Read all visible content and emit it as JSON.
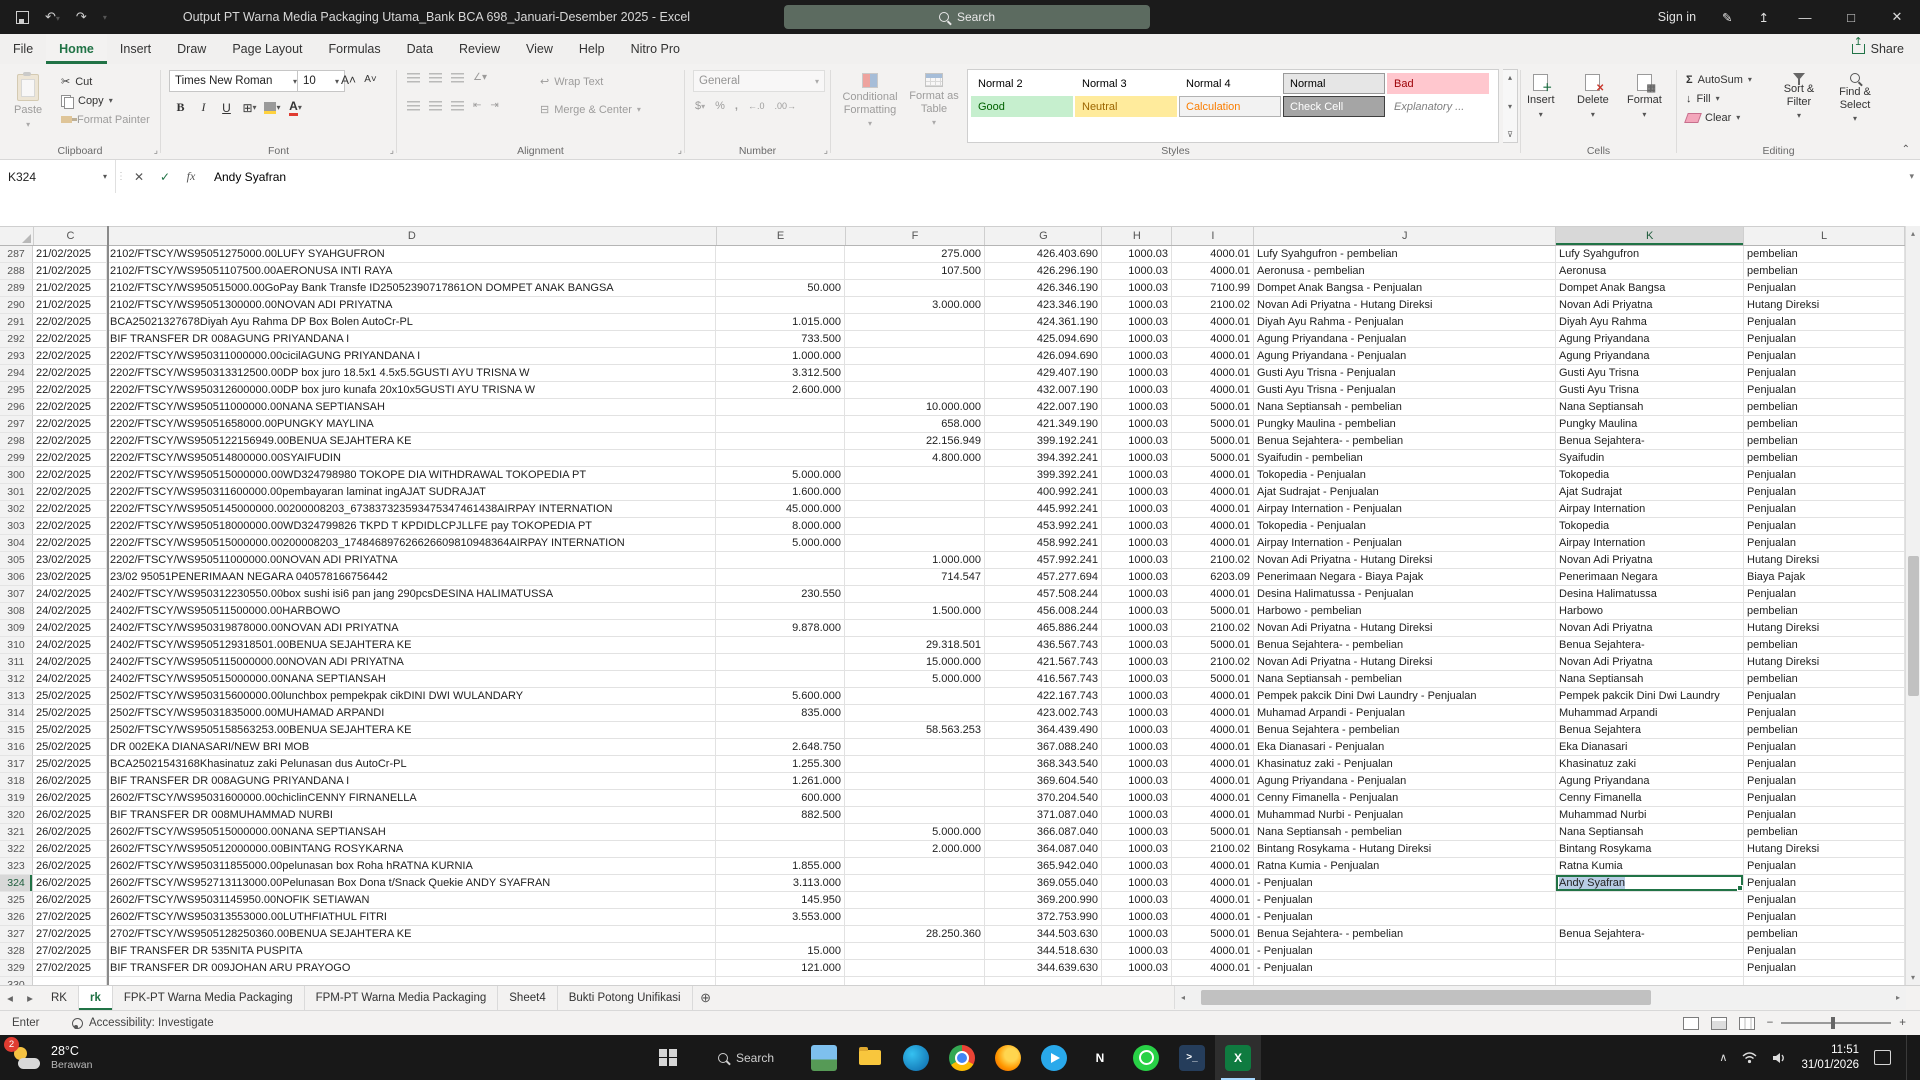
{
  "titlebar": {
    "title": "Output PT Warna Media Packaging Utama_Bank BCA 698_Januari-Desember 2025  -  Excel",
    "search_label": "Search",
    "sign_in_label": "Sign in"
  },
  "ribbon": {
    "tabs": [
      "File",
      "Home",
      "Insert",
      "Draw",
      "Page Layout",
      "Formulas",
      "Data",
      "Review",
      "View",
      "Help",
      "Nitro Pro"
    ],
    "active_tab": "Home",
    "share_label": "Share",
    "clipboard": {
      "group": "Clipboard",
      "paste": "Paste",
      "cut": "Cut",
      "copy": "Copy",
      "format_painter": "Format Painter"
    },
    "font": {
      "group": "Font",
      "name": "Times New Roman",
      "size": "10"
    },
    "alignment": {
      "group": "Alignment",
      "wrap": "Wrap Text",
      "merge": "Merge & Center"
    },
    "number": {
      "group": "Number",
      "format": "General"
    },
    "styles": {
      "group": "Styles",
      "conditional": "Conditional Formatting",
      "format_table": "Format as Table",
      "chips": [
        {
          "label": "Normal 2",
          "type": "normal"
        },
        {
          "label": "Normal 3",
          "type": "normal"
        },
        {
          "label": "Normal 4",
          "type": "normal"
        },
        {
          "label": "Normal",
          "type": "normal-selected"
        },
        {
          "label": "Bad",
          "type": "bad"
        },
        {
          "label": "Good",
          "type": "good"
        },
        {
          "label": "Neutral",
          "type": "neutral"
        },
        {
          "label": "Calculation",
          "type": "calculation"
        },
        {
          "label": "Check Cell",
          "type": "check"
        },
        {
          "label": "Explanatory ...",
          "type": "explanatory"
        }
      ]
    },
    "cells": {
      "group": "Cells",
      "insert": "Insert",
      "delete": "Delete",
      "format": "Format"
    },
    "editing": {
      "group": "Editing",
      "autosum": "AutoSum",
      "fill": "Fill",
      "clear": "Clear",
      "sort": "Sort & Filter",
      "find": "Find & Select"
    }
  },
  "formula_bar": {
    "name_box": "K324",
    "value": "Andy Syafran"
  },
  "grid": {
    "columns": [
      "C",
      "D",
      "E",
      "F",
      "G",
      "H",
      "I",
      "J",
      "K",
      "L"
    ],
    "selected": {
      "row": "324",
      "col": "K",
      "value": "Andy Syafran"
    },
    "rows": [
      [
        "287",
        "21/02/2025",
        "2102/FTSCY/WS95051275000.00LUFY SYAHGUFRON",
        "",
        "275.000",
        "426.403.690",
        "1000.03",
        "4000.01",
        "Lufy Syahgufron - pembelian",
        "Lufy Syahgufron",
        "pembelian"
      ],
      [
        "288",
        "21/02/2025",
        "2102/FTSCY/WS95051107500.00AERONUSA INTI RAYA",
        "",
        "107.500",
        "426.296.190",
        "1000.03",
        "4000.01",
        "Aeronusa - pembelian",
        "Aeronusa",
        "pembelian"
      ],
      [
        "289",
        "21/02/2025",
        "2102/FTSCY/WS950515000.00GoPay Bank Transfe ID25052390717861ON DOMPET ANAK BANGSA",
        "50.000",
        "",
        "426.346.190",
        "1000.03",
        "7100.99",
        "Dompet Anak Bangsa - Penjualan",
        "Dompet Anak Bangsa",
        "Penjualan"
      ],
      [
        "290",
        "21/02/2025",
        "2102/FTSCY/WS95051300000.00NOVAN ADI PRIYATNA",
        "",
        "3.000.000",
        "423.346.190",
        "1000.03",
        "2100.02",
        "Novan Adi Priyatna - Hutang Direksi",
        "Novan Adi Priyatna",
        "Hutang Direksi"
      ],
      [
        "291",
        "22/02/2025",
        "BCA25021327678Diyah Ayu Rahma DP Box Bolen AutoCr-PL",
        "1.015.000",
        "",
        "424.361.190",
        "1000.03",
        "4000.01",
        "Diyah Ayu Rahma - Penjualan",
        "Diyah Ayu Rahma",
        "Penjualan"
      ],
      [
        "292",
        "22/02/2025",
        "BIF TRANSFER DR 008AGUNG PRIYANDANA I",
        "733.500",
        "",
        "425.094.690",
        "1000.03",
        "4000.01",
        "Agung Priyandana - Penjualan",
        "Agung Priyandana",
        "Penjualan"
      ],
      [
        "293",
        "22/02/2025",
        "2202/FTSCY/WS950311000000.00cicilAGUNG PRIYANDANA I",
        "1.000.000",
        "",
        "426.094.690",
        "1000.03",
        "4000.01",
        "Agung Priyandana - Penjualan",
        "Agung Priyandana",
        "Penjualan"
      ],
      [
        "294",
        "22/02/2025",
        "2202/FTSCY/WS950313312500.00DP box juro 18.5x1 4.5x5.5GUSTI AYU TRISNA W",
        "3.312.500",
        "",
        "429.407.190",
        "1000.03",
        "4000.01",
        "Gusti Ayu Trisna - Penjualan",
        "Gusti Ayu Trisna",
        "Penjualan"
      ],
      [
        "295",
        "22/02/2025",
        "2202/FTSCY/WS950312600000.00DP box juro kunafa 20x10x5GUSTI AYU TRISNA W",
        "2.600.000",
        "",
        "432.007.190",
        "1000.03",
        "4000.01",
        "Gusti Ayu Trisna - Penjualan",
        "Gusti Ayu Trisna",
        "Penjualan"
      ],
      [
        "296",
        "22/02/2025",
        "2202/FTSCY/WS950511000000.00NANA SEPTIANSAH",
        "",
        "10.000.000",
        "422.007.190",
        "1000.03",
        "5000.01",
        "Nana Septiansah - pembelian",
        "Nana Septiansah",
        "pembelian"
      ],
      [
        "297",
        "22/02/2025",
        "2202/FTSCY/WS95051658000.00PUNGKY MAYLINA",
        "",
        "658.000",
        "421.349.190",
        "1000.03",
        "5000.01",
        "Pungky Maulina - pembelian",
        "Pungky Maulina",
        "pembelian"
      ],
      [
        "298",
        "22/02/2025",
        "2202/FTSCY/WS9505122156949.00BENUA SEJAHTERA KE",
        "",
        "22.156.949",
        "399.192.241",
        "1000.03",
        "5000.01",
        "Benua Sejahtera- - pembelian",
        "Benua Sejahtera-",
        "pembelian"
      ],
      [
        "299",
        "22/02/2025",
        "2202/FTSCY/WS950514800000.00SYAIFUDIN",
        "",
        "4.800.000",
        "394.392.241",
        "1000.03",
        "5000.01",
        "Syaifudin - pembelian",
        "Syaifudin",
        "pembelian"
      ],
      [
        "300",
        "22/02/2025",
        "2202/FTSCY/WS950515000000.00WD324798980 TOKOPE DIA WITHDRAWAL TOKOPEDIA PT",
        "5.000.000",
        "",
        "399.392.241",
        "1000.03",
        "4000.01",
        "Tokopedia - Penjualan",
        "Tokopedia",
        "Penjualan"
      ],
      [
        "301",
        "22/02/2025",
        "2202/FTSCY/WS950311600000.00pembayaran laminat ingAJAT SUDRAJAT",
        "1.600.000",
        "",
        "400.992.241",
        "1000.03",
        "4000.01",
        "Ajat Sudrajat - Penjualan",
        "Ajat Sudrajat",
        "Penjualan"
      ],
      [
        "302",
        "22/02/2025",
        "2202/FTSCY/WS9505145000000.00200008203_673837323593475347461438AIRPAY INTERNATION",
        "45.000.000",
        "",
        "445.992.241",
        "1000.03",
        "4000.01",
        "Airpay Internation - Penjualan",
        "Airpay Internation",
        "Penjualan"
      ],
      [
        "303",
        "22/02/2025",
        "2202/FTSCY/WS950518000000.00WD324799826 TKPD T KPDIDLCPJLLFE pay TOKOPEDIA PT",
        "8.000.000",
        "",
        "453.992.241",
        "1000.03",
        "4000.01",
        "Tokopedia - Penjualan",
        "Tokopedia",
        "Penjualan"
      ],
      [
        "304",
        "22/02/2025",
        "2202/FTSCY/WS950515000000.00200008203_174846897626626609810948364AIRPAY INTERNATION",
        "5.000.000",
        "",
        "458.992.241",
        "1000.03",
        "4000.01",
        "Airpay Internation - Penjualan",
        "Airpay Internation",
        "Penjualan"
      ],
      [
        "305",
        "23/02/2025",
        "2202/FTSCY/WS950511000000.00NOVAN ADI PRIYATNA",
        "",
        "1.000.000",
        "457.992.241",
        "1000.03",
        "2100.02",
        "Novan Adi Priyatna - Hutang Direksi",
        "Novan Adi Priyatna",
        "Hutang Direksi"
      ],
      [
        "306",
        "23/02/2025",
        "23/02 95051PENERIMAAN NEGARA 040578166756442",
        "",
        "714.547",
        "457.277.694",
        "1000.03",
        "6203.09",
        "Penerimaan Negara - Biaya Pajak",
        "Penerimaan Negara",
        "Biaya Pajak"
      ],
      [
        "307",
        "24/02/2025",
        "2402/FTSCY/WS950312230550.00box sushi isi6 pan jang 290pcsDESINA HALIMATUSSA",
        "230.550",
        "",
        "457.508.244",
        "1000.03",
        "4000.01",
        "Desina Halimatussa - Penjualan",
        "Desina Halimatussa",
        "Penjualan"
      ],
      [
        "308",
        "24/02/2025",
        "2402/FTSCY/WS950511500000.00HARBOWO",
        "",
        "1.500.000",
        "456.008.244",
        "1000.03",
        "5000.01",
        "Harbowo - pembelian",
        "Harbowo",
        "pembelian"
      ],
      [
        "309",
        "24/02/2025",
        "2402/FTSCY/WS950319878000.00NOVAN ADI PRIYATNA",
        "9.878.000",
        "",
        "465.886.244",
        "1000.03",
        "2100.02",
        "Novan Adi Priyatna - Hutang Direksi",
        "Novan Adi Priyatna",
        "Hutang Direksi"
      ],
      [
        "310",
        "24/02/2025",
        "2402/FTSCY/WS9505129318501.00BENUA SEJAHTERA KE",
        "",
        "29.318.501",
        "436.567.743",
        "1000.03",
        "5000.01",
        "Benua Sejahtera- - pembelian",
        "Benua Sejahtera-",
        "pembelian"
      ],
      [
        "311",
        "24/02/2025",
        "2402/FTSCY/WS9505115000000.00NOVAN ADI PRIYATNA",
        "",
        "15.000.000",
        "421.567.743",
        "1000.03",
        "2100.02",
        "Novan Adi Priyatna - Hutang Direksi",
        "Novan Adi Priyatna",
        "Hutang Direksi"
      ],
      [
        "312",
        "24/02/2025",
        "2402/FTSCY/WS950515000000.00NANA SEPTIANSAH",
        "",
        "5.000.000",
        "416.567.743",
        "1000.03",
        "5000.01",
        "Nana Septiansah - pembelian",
        "Nana Septiansah",
        "pembelian"
      ],
      [
        "313",
        "25/02/2025",
        "2502/FTSCY/WS950315600000.00lunchbox pempekpak cikDINI DWI WULANDARY",
        "5.600.000",
        "",
        "422.167.743",
        "1000.03",
        "4000.01",
        "Pempek pakcik Dini Dwi Laundry - Penjualan",
        "Pempek pakcik Dini Dwi Laundry",
        "Penjualan"
      ],
      [
        "314",
        "25/02/2025",
        "2502/FTSCY/WS95031835000.00MUHAMAD ARPANDI",
        "835.000",
        "",
        "423.002.743",
        "1000.03",
        "4000.01",
        "Muhamad Arpandi - Penjualan",
        "Muhammad Arpandi",
        "Penjualan"
      ],
      [
        "315",
        "25/02/2025",
        "2502/FTSCY/WS9505158563253.00BENUA SEJAHTERA KE",
        "",
        "58.563.253",
        "364.439.490",
        "1000.03",
        "4000.01",
        "Benua Sejahtera - pembelian",
        "Benua Sejahtera",
        "pembelian"
      ],
      [
        "316",
        "25/02/2025",
        "DR 002EKA DIANASARI/NEW BRI MOB",
        "2.648.750",
        "",
        "367.088.240",
        "1000.03",
        "4000.01",
        "Eka Dianasari - Penjualan",
        "Eka Dianasari",
        "Penjualan"
      ],
      [
        "317",
        "25/02/2025",
        "BCA25021543168Khasinatuz zaki Pelunasan dus AutoCr-PL",
        "1.255.300",
        "",
        "368.343.540",
        "1000.03",
        "4000.01",
        "Khasinatuz zaki - Penjualan",
        "Khasinatuz zaki",
        "Penjualan"
      ],
      [
        "318",
        "26/02/2025",
        "BIF TRANSFER DR 008AGUNG PRIYANDANA I",
        "1.261.000",
        "",
        "369.604.540",
        "1000.03",
        "4000.01",
        "Agung Priyandana - Penjualan",
        "Agung Priyandana",
        "Penjualan"
      ],
      [
        "319",
        "26/02/2025",
        "2602/FTSCY/WS95031600000.00chiclinCENNY FIRNANELLA",
        "600.000",
        "",
        "370.204.540",
        "1000.03",
        "4000.01",
        "Cenny Fimanella - Penjualan",
        "Cenny Fimanella",
        "Penjualan"
      ],
      [
        "320",
        "26/02/2025",
        "BIF TRANSFER DR 008MUHAMMAD NURBI",
        "882.500",
        "",
        "371.087.040",
        "1000.03",
        "4000.01",
        "Muhammad Nurbi - Penjualan",
        "Muhammad Nurbi",
        "Penjualan"
      ],
      [
        "321",
        "26/02/2025",
        "2602/FTSCY/WS950515000000.00NANA SEPTIANSAH",
        "",
        "5.000.000",
        "366.087.040",
        "1000.03",
        "5000.01",
        "Nana Septiansah - pembelian",
        "Nana Septiansah",
        "pembelian"
      ],
      [
        "322",
        "26/02/2025",
        "2602/FTSCY/WS950512000000.00BINTANG ROSYKARNA",
        "",
        "2.000.000",
        "364.087.040",
        "1000.03",
        "2100.02",
        "Bintang Rosykama - Hutang Direksi",
        "Bintang Rosykama",
        "Hutang Direksi"
      ],
      [
        "323",
        "26/02/2025",
        "2602/FTSCY/WS950311855000.00pelunasan box Roha hRATNA KURNIA",
        "1.855.000",
        "",
        "365.942.040",
        "1000.03",
        "4000.01",
        "Ratna Kumia - Penjualan",
        "Ratna Kumia",
        "Penjualan"
      ],
      [
        "324",
        "26/02/2025",
        "2602/FTSCY/WS952713113000.00Pelunasan Box Dona t/Snack Quekie ANDY SYAFRAN",
        "3.113.000",
        "",
        "369.055.040",
        "1000.03",
        "4000.01",
        " - Penjualan",
        "Andy Syafran",
        "Penjualan"
      ],
      [
        "325",
        "26/02/2025",
        "2602/FTSCY/WS95031145950.00NOFIK SETIAWAN",
        "145.950",
        "",
        "369.200.990",
        "1000.03",
        "4000.01",
        " - Penjualan",
        "",
        "Penjualan"
      ],
      [
        "326",
        "27/02/2025",
        "2602/FTSCY/WS950313553000.00LUTHFIATHUL FITRI",
        "3.553.000",
        "",
        "372.753.990",
        "1000.03",
        "4000.01",
        " - Penjualan",
        "",
        "Penjualan"
      ],
      [
        "327",
        "27/02/2025",
        "2702/FTSCY/WS9505128250360.00BENUA SEJAHTERA KE",
        "",
        "28.250.360",
        "344.503.630",
        "1000.03",
        "5000.01",
        "Benua Sejahtera- - pembelian",
        "Benua Sejahtera-",
        "pembelian"
      ],
      [
        "328",
        "27/02/2025",
        "BIF TRANSFER DR 535NITA PUSPITA",
        "15.000",
        "",
        "344.518.630",
        "1000.03",
        "4000.01",
        " - Penjualan",
        "",
        "Penjualan"
      ],
      [
        "329",
        "27/02/2025",
        "BIF TRANSFER DR 009JOHAN ARU PRAYOGO",
        "121.000",
        "",
        "344.639.630",
        "1000.03",
        "4000.01",
        " - Penjualan",
        "",
        "Penjualan"
      ]
    ]
  },
  "sheet_bar": {
    "tabs": [
      "RK",
      "rk",
      "FPK-PT Warna Media Packaging",
      "FPM-PT Warna Media Packaging",
      "Sheet4",
      "Bukti Potong Unifikasi"
    ],
    "active": "rk"
  },
  "status_bar": {
    "mode": "Enter",
    "accessibility": "Accessibility: Investigate"
  },
  "taskbar": {
    "weather": {
      "temp": "28°C",
      "desc": "Berawan",
      "badge": "2"
    },
    "search_label": "Search",
    "apps": [
      "photos",
      "file-explorer",
      "edge",
      "chrome",
      "firefox",
      "telegram",
      "nitro-pdf",
      "whatsapp",
      "terminal",
      "excel"
    ],
    "active_app": "excel",
    "clock": {
      "time": "11:51",
      "date": "31/01/2026"
    }
  }
}
